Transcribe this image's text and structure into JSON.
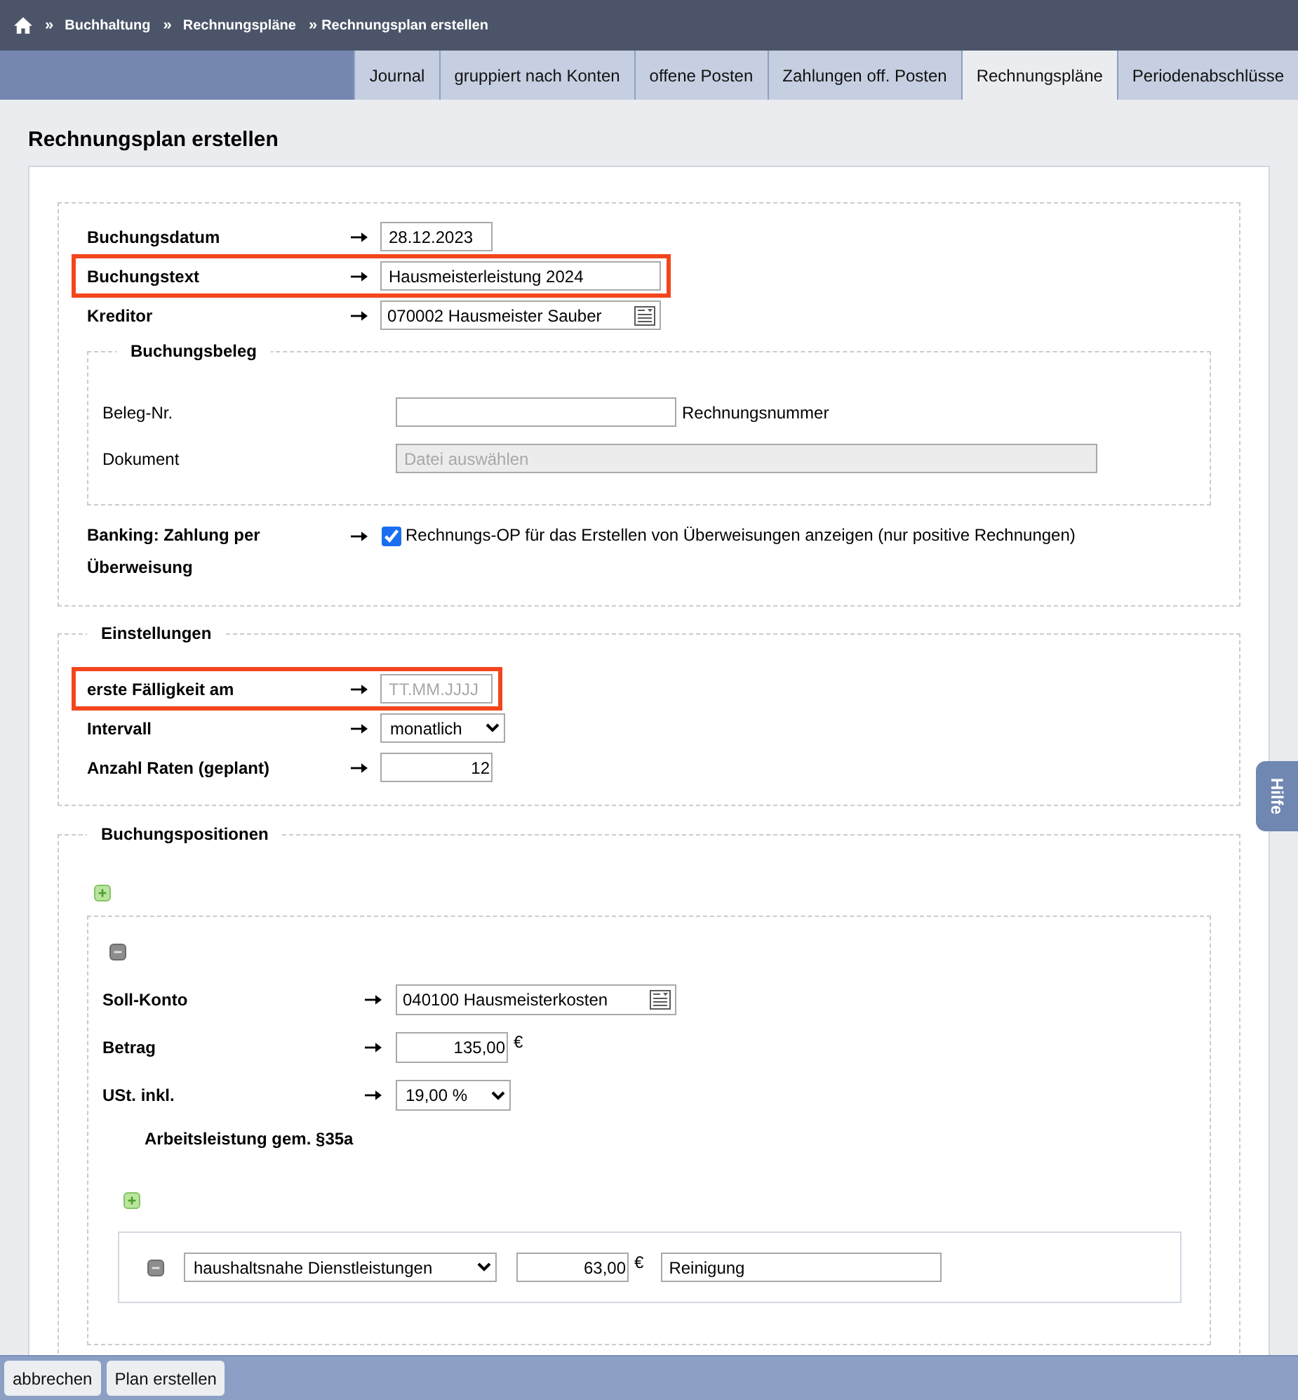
{
  "breadcrumb": [
    {
      "separator": "»",
      "label": "Buchhaltung"
    },
    {
      "separator": "»",
      "label": "Rechnungspläne"
    },
    {
      "separator": "»",
      "label": "Rechnungsplan erstellen"
    }
  ],
  "tabs": [
    {
      "label": "Journal",
      "selected": false
    },
    {
      "label": "gruppiert nach Konten",
      "selected": false
    },
    {
      "label": "offene Posten",
      "selected": false
    },
    {
      "label": "Zahlungen off. Posten",
      "selected": false
    },
    {
      "label": "Rechnungspläne",
      "selected": true
    },
    {
      "label": "Periodenabschlüsse",
      "selected": false
    }
  ],
  "page_title": "Rechnungsplan erstellen",
  "booking": {
    "fields": [
      {
        "kind": "date",
        "label": "Buchungsdatum",
        "value": "28.12.2023",
        "highlighted": false
      },
      {
        "kind": "text",
        "label": "Buchungstext",
        "value": "Hausmeisterleistung 2024",
        "highlighted": true
      },
      {
        "kind": "lookup",
        "label": "Kreditor",
        "value": "070002 Hausmeister Sauber",
        "highlighted": false
      }
    ],
    "document": {
      "legend": "Buchungsbeleg",
      "fields": [
        {
          "kind": "text",
          "label": "Beleg-Nr.",
          "suffix": "Rechnungsnummer",
          "disabled": false
        },
        {
          "kind": "file",
          "label": "Dokument",
          "placeholder": "Datei auswählen",
          "disabled": true
        }
      ]
    },
    "banking": {
      "label": "Banking: Zahlung per Überweisung",
      "checked": true,
      "text": "Rechnungs-OP für das Erstellen von Überweisungen anzeigen (nur positive Rechnungen)"
    }
  },
  "settings": {
    "legend": "Einstellungen",
    "fields": [
      {
        "kind": "date",
        "label": "erste Fälligkeit am",
        "placeholder": "TT.MM.JJJJ",
        "highlighted": true
      },
      {
        "kind": "select",
        "label": "Intervall",
        "value": "monatlich",
        "highlighted": false
      },
      {
        "kind": "number",
        "label": "Anzahl Raten (geplant)",
        "value": "12",
        "highlighted": false
      }
    ]
  },
  "positions": {
    "legend": "Buchungspositionen",
    "items": [
      {
        "fields": [
          {
            "kind": "lookup",
            "label": "Soll-Konto",
            "value": "040100 Hausmeisterkosten"
          },
          {
            "kind": "amount",
            "label": "Betrag",
            "value": "135,00",
            "currency": "€"
          },
          {
            "kind": "select",
            "label": "USt. inkl.",
            "value": "19,00 %"
          }
        ],
        "labor": {
          "title": "Arbeitsleistung gem. §35a",
          "items": [
            {
              "category": "haushaltsnahe Dienstleistungen",
              "amount": "63,00",
              "currency": "€",
              "description": "Reinigung"
            }
          ]
        }
      }
    ]
  },
  "help_tab": {
    "label": "Hilfe"
  },
  "footer_buttons": [
    "abbrechen",
    "Plan erstellen"
  ]
}
